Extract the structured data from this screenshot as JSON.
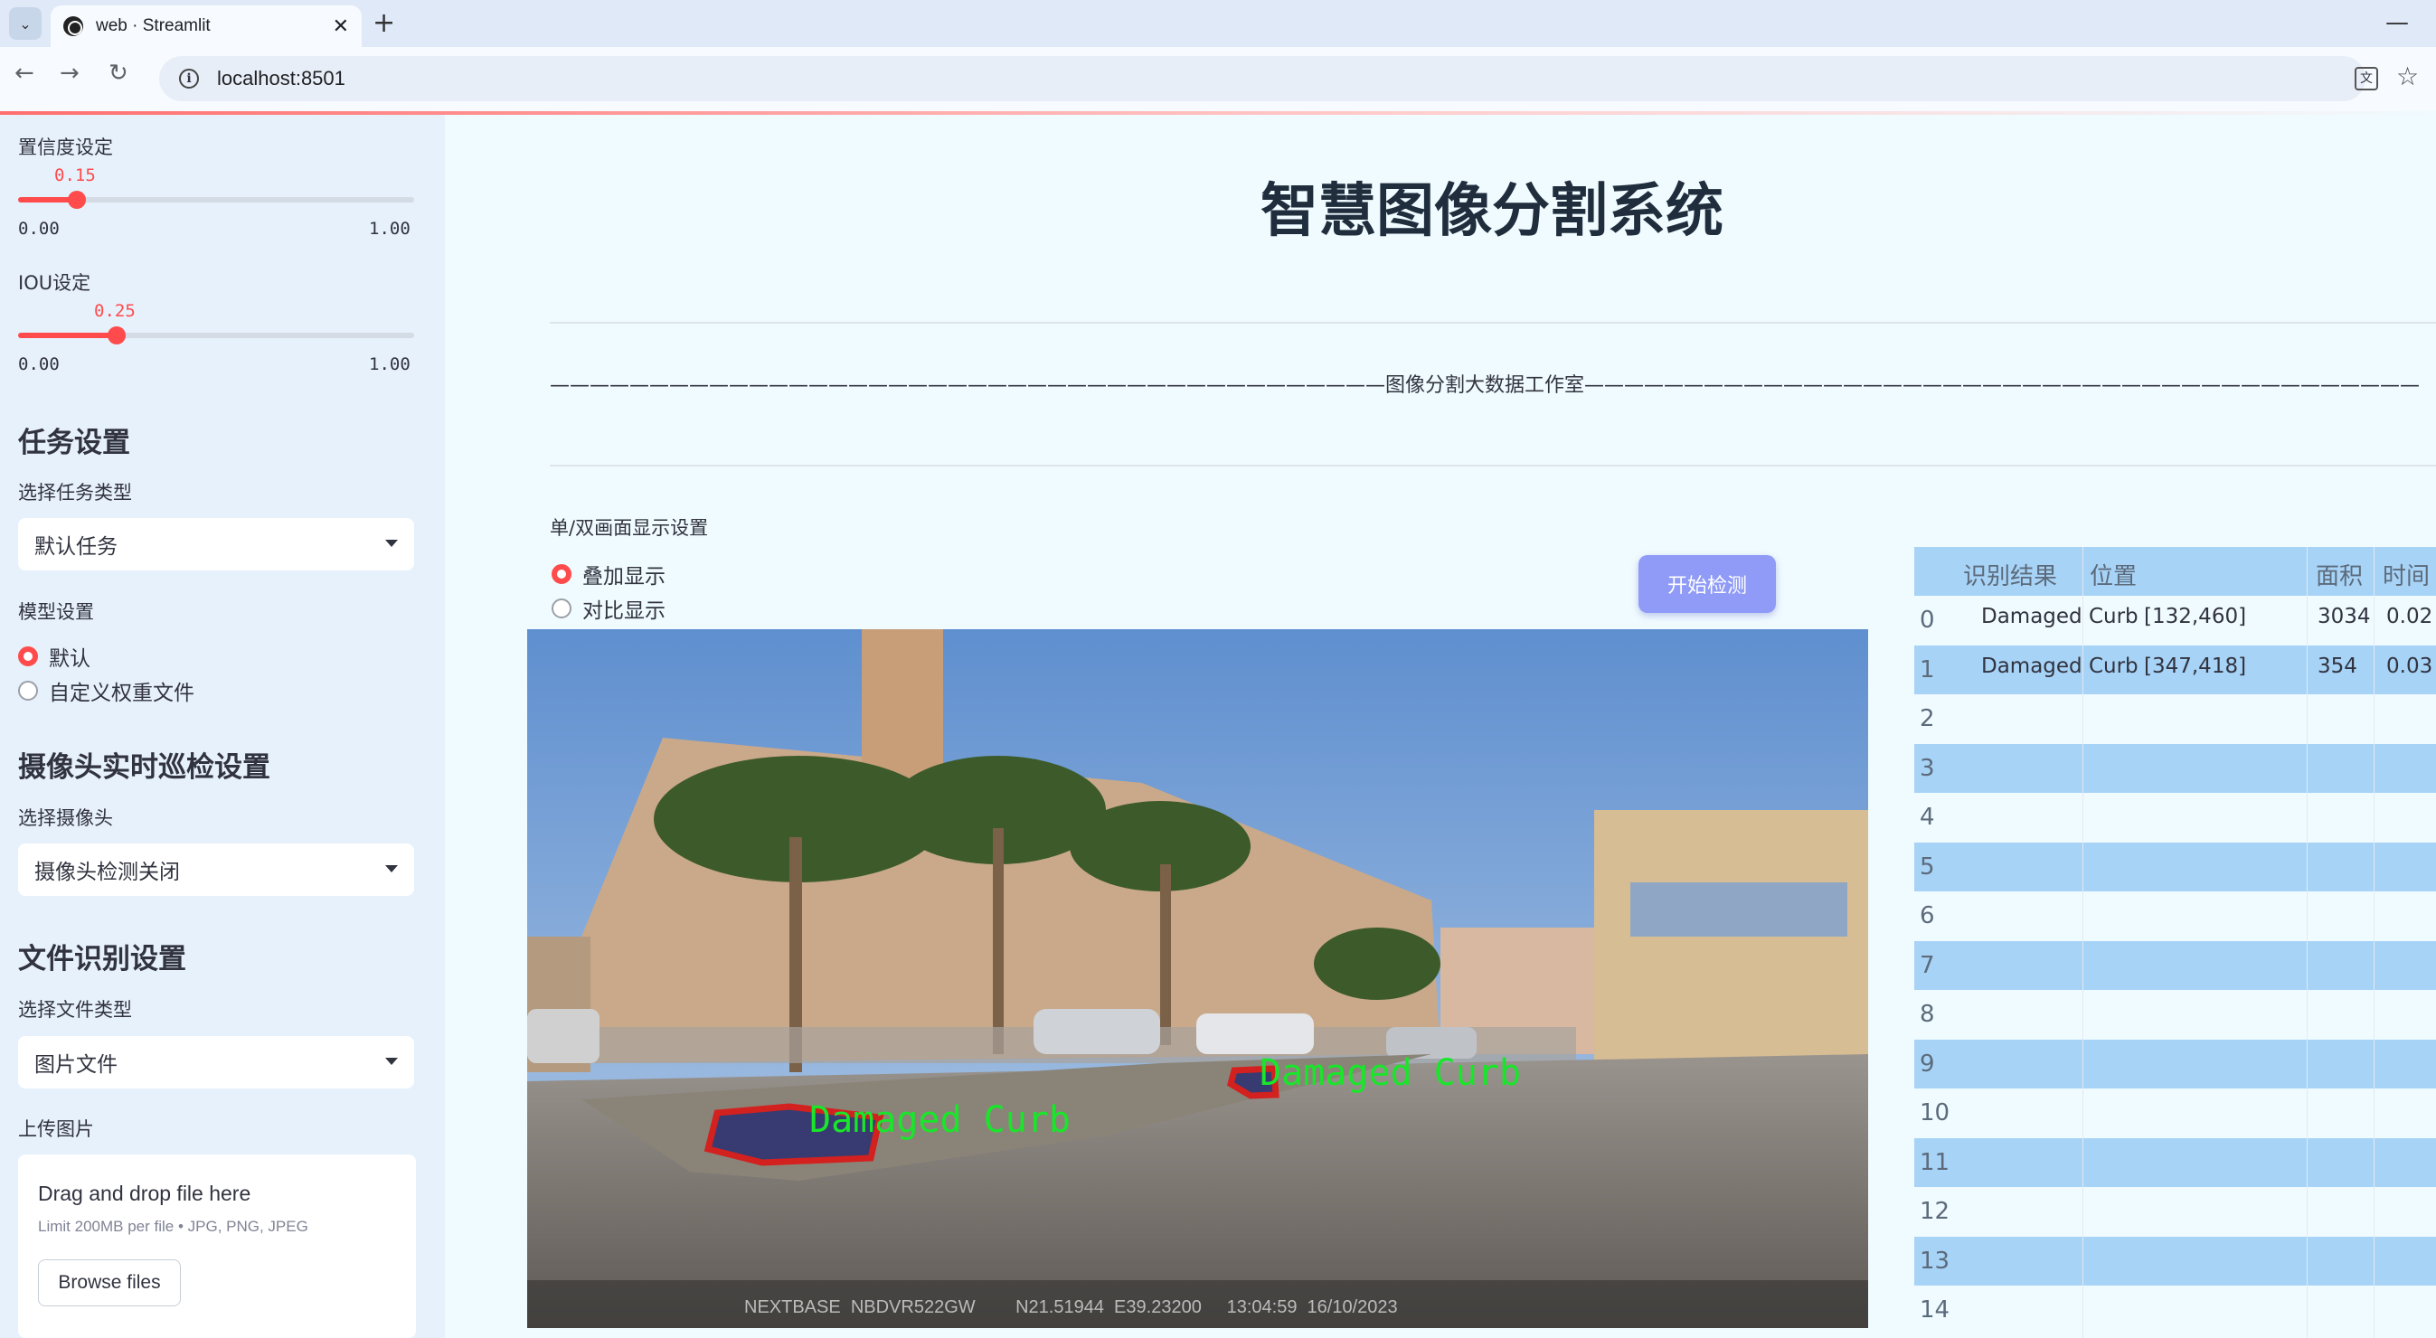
{
  "browser": {
    "tab_title": "web · Streamlit",
    "url": "localhost:8501"
  },
  "sidebar": {
    "confidence": {
      "label": "置信度设定",
      "value": "0.15",
      "value_fraction": 0.15,
      "min": "0.00",
      "max": "1.00"
    },
    "iou": {
      "label": "IOU设定",
      "value": "0.25",
      "value_fraction": 0.25,
      "min": "0.00",
      "max": "1.00"
    },
    "task_section": "任务设置",
    "task_type_label": "选择任务类型",
    "task_type_value": "默认任务",
    "model_label": "模型设置",
    "model_options": [
      "默认",
      "自定义权重文件"
    ],
    "model_selected": "默认",
    "camera_section": "摄像头实时巡检设置",
    "camera_label": "选择摄像头",
    "camera_value": "摄像头检测关闭",
    "file_section": "文件识别设置",
    "file_type_label": "选择文件类型",
    "file_type_value": "图片文件",
    "upload_label": "上传图片",
    "upload_title": "Drag and drop file here",
    "upload_limit": "Limit 200MB per file • JPG, PNG, JPEG",
    "browse_label": "Browse files"
  },
  "main": {
    "title": "智慧图像分割系统",
    "studio_line": "——————————————————————————————————————————图像分割大数据工作室——————————————————————————————————————————",
    "display_label": "单/双画面显示设置",
    "display_options": [
      "叠加显示",
      "对比显示"
    ],
    "display_selected": "叠加显示",
    "start_button": "开始检测",
    "image_overlay": {
      "label_1": "Damaged Curb",
      "label_2": "Damaged Curb",
      "dashcam_text": "NEXTBASE  NBDVR522GW        N21.51944  E39.23200     13:04:59  16/10/2023"
    }
  },
  "results_table": {
    "headers": [
      "识别结果",
      "位置",
      "面积",
      "时间"
    ],
    "rows": [
      {
        "index": "0",
        "result": "Damaged Curb",
        "position": "[132,460]",
        "area": "3034",
        "time": "0.02"
      },
      {
        "index": "1",
        "result": "Damaged Curb",
        "position": "[347,418]",
        "area": "354",
        "time": "0.03"
      },
      {
        "index": "2"
      },
      {
        "index": "3"
      },
      {
        "index": "4"
      },
      {
        "index": "5"
      },
      {
        "index": "6"
      },
      {
        "index": "7"
      },
      {
        "index": "8"
      },
      {
        "index": "9"
      },
      {
        "index": "10"
      },
      {
        "index": "11"
      },
      {
        "index": "12"
      },
      {
        "index": "13"
      },
      {
        "index": "14"
      }
    ]
  },
  "colors": {
    "accent": "#ff4b4b",
    "button": "#8f9bf6",
    "table_stripe": "#a7d3f7",
    "sidebar_bg": "#e6f1fc"
  }
}
